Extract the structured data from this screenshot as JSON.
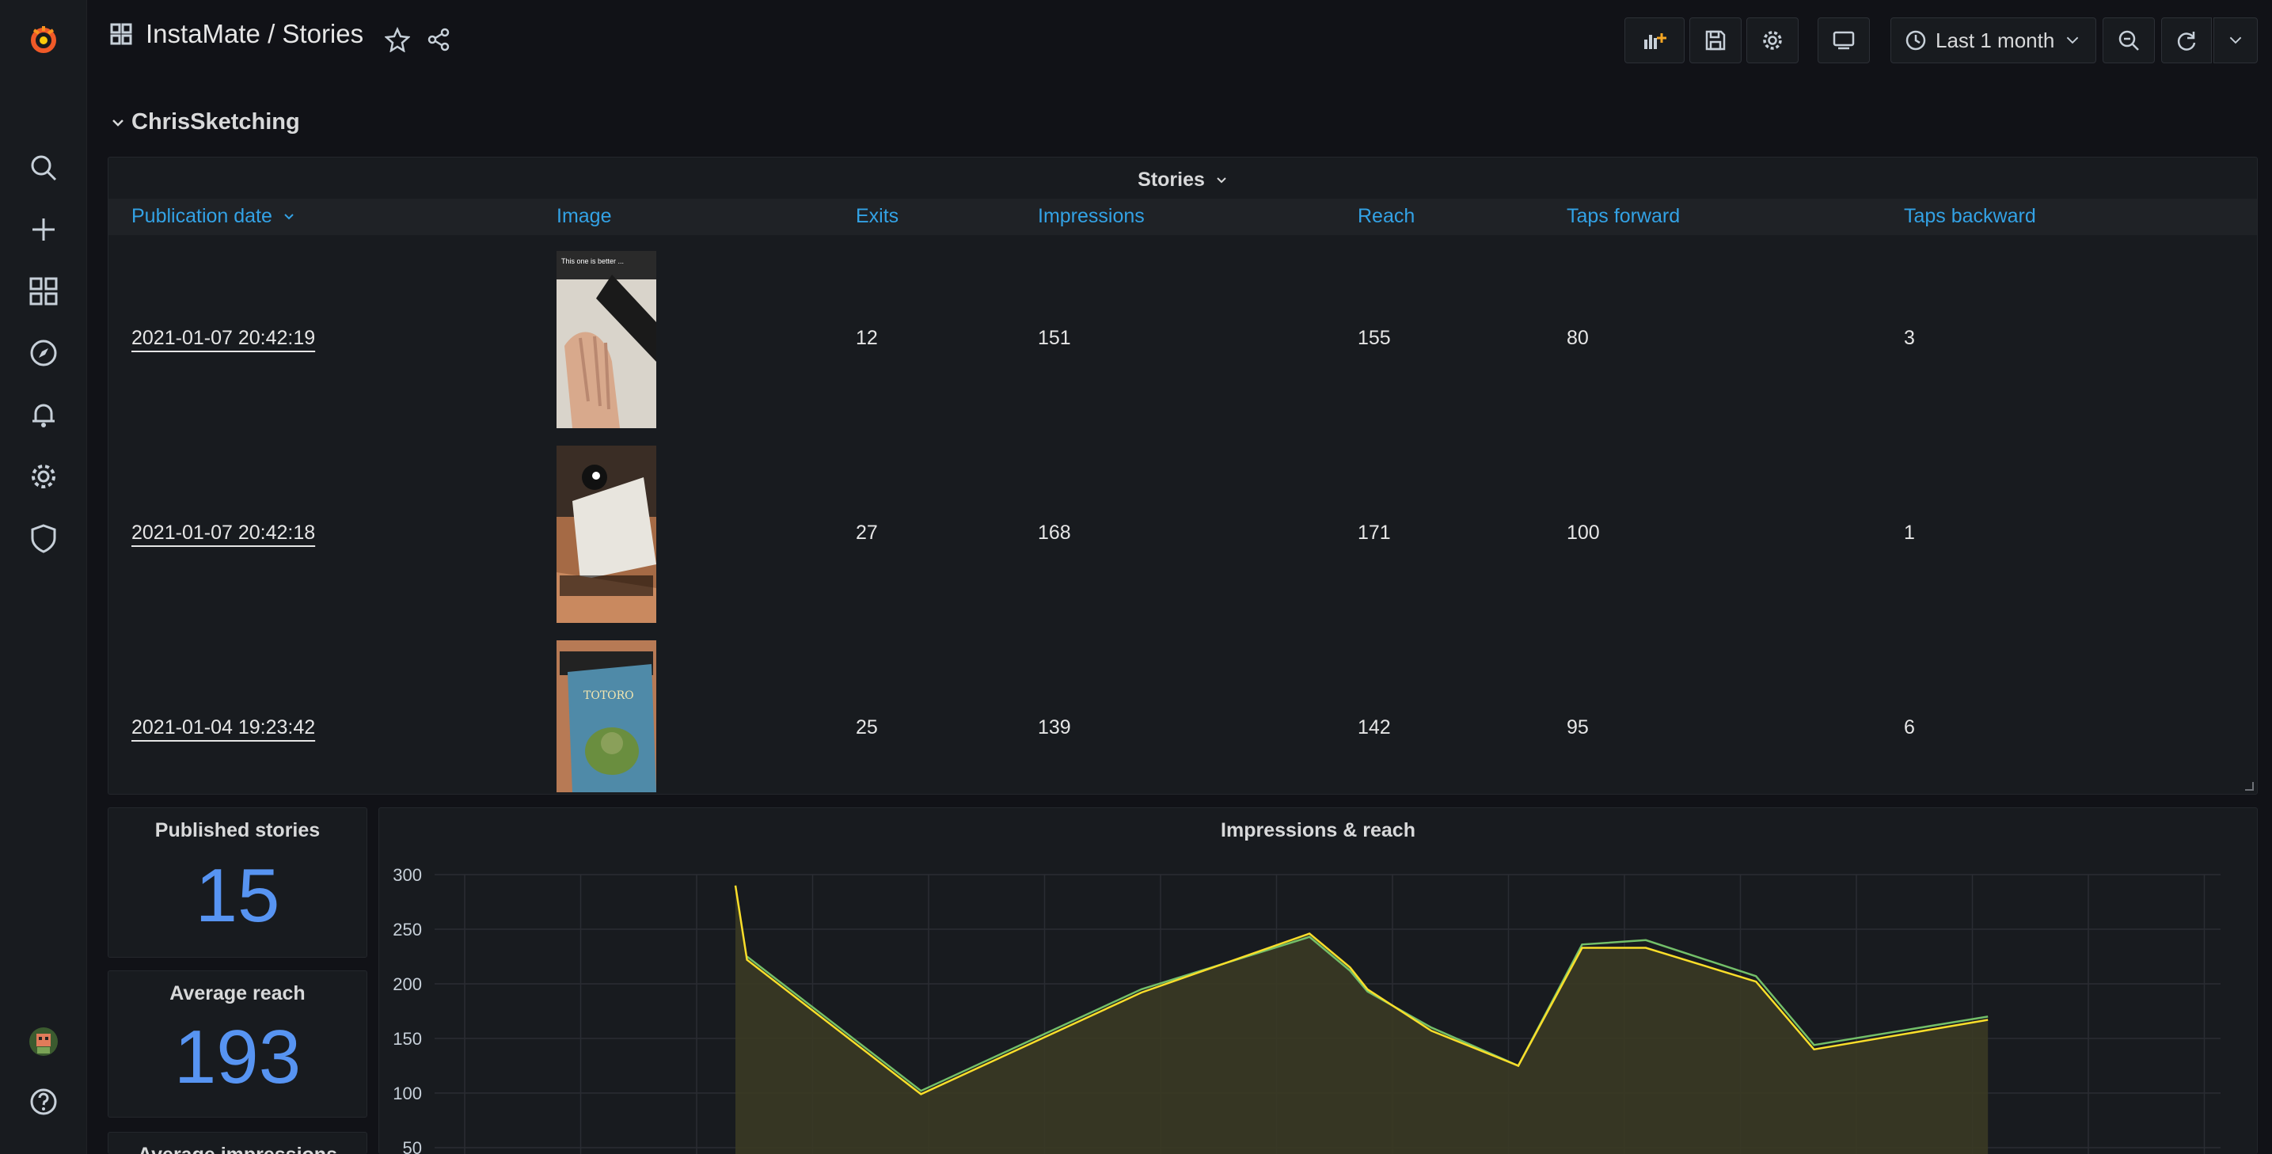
{
  "app": {
    "breadcrumb": "InstaMate / Stories",
    "time_range": "Last 1 month"
  },
  "row": {
    "title": "ChrisSketching"
  },
  "stories_panel": {
    "title": "Stories",
    "columns": [
      "Publication date",
      "Image",
      "Exits",
      "Impressions",
      "Reach",
      "Taps forward",
      "Taps backward"
    ],
    "rows": [
      {
        "date": "2021-01-07 20:42:19",
        "image_caption": "This one is better ...",
        "exits": "12",
        "impressions": "151",
        "reach": "155",
        "taps_forward": "80",
        "taps_backward": "3"
      },
      {
        "date": "2021-01-07 20:42:18",
        "image_caption": "",
        "exits": "27",
        "impressions": "168",
        "reach": "171",
        "taps_forward": "100",
        "taps_backward": "1"
      },
      {
        "date": "2021-01-04 19:23:42",
        "image_caption": "TOTORO",
        "exits": "25",
        "impressions": "139",
        "reach": "142",
        "taps_forward": "95",
        "taps_backward": "6"
      }
    ]
  },
  "stats": [
    {
      "title": "Published stories",
      "value": "15"
    },
    {
      "title": "Average reach",
      "value": "193"
    },
    {
      "title": "Average impressions",
      "value": ""
    }
  ],
  "chart_data": {
    "type": "area",
    "title": "Impressions & reach",
    "ylim": [
      50,
      300
    ],
    "yticks": [
      "300",
      "250",
      "200",
      "150",
      "100",
      "50"
    ],
    "grid": true,
    "x": [
      0.0,
      0.1,
      1.6,
      3.5,
      4.95,
      5.3,
      5.45,
      6.0,
      6.75,
      7.3,
      7.85,
      8.8,
      9.3,
      10.8
    ],
    "series": [
      {
        "values": [
          290,
          222,
          99,
          192,
          246,
          215,
          195,
          157,
          125,
          233,
          233,
          202,
          140,
          167
        ],
        "color": "#fade2a"
      },
      {
        "values": [
          null,
          225,
          102,
          195,
          243,
          212,
          193,
          160,
          125,
          236,
          240,
          207,
          144,
          170
        ],
        "color": "#73bf69"
      }
    ],
    "colors": {
      "accent": "#33a2e5",
      "stat": "#5794f2",
      "fill": "#3a3a23"
    }
  }
}
